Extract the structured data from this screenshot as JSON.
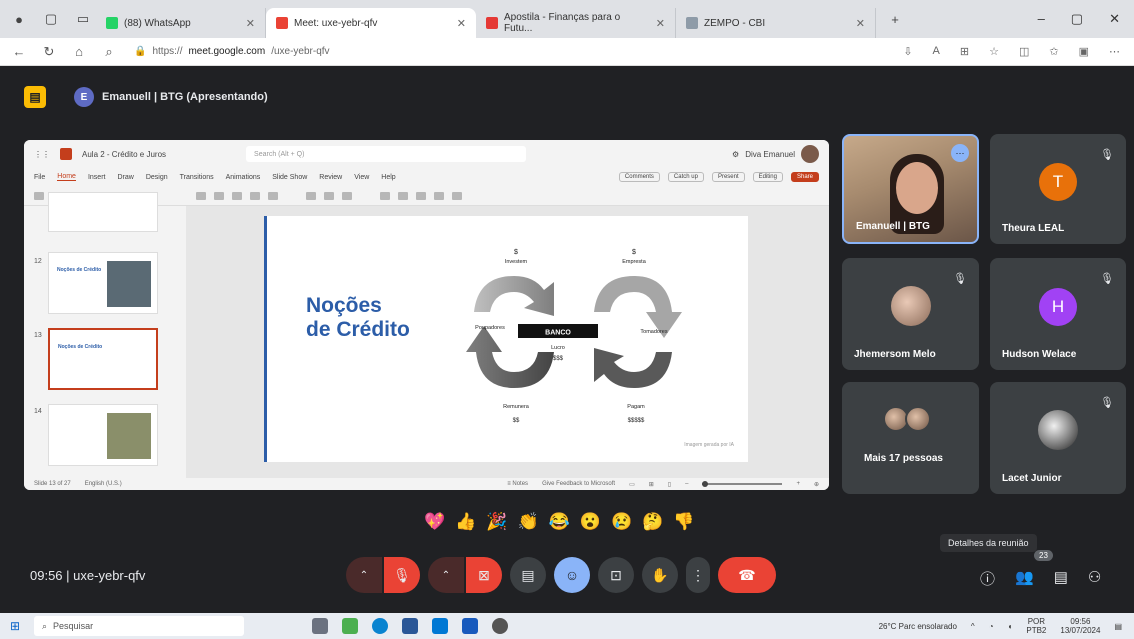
{
  "browser": {
    "tabs": [
      {
        "label": "(88) WhatsApp",
        "color": "#25d366"
      },
      {
        "label": "Meet: uxe-yebr-qfv",
        "color": "#ea4335",
        "active": true
      },
      {
        "label": "Apostila - Finanças para o Futu...",
        "color": "#e53935"
      },
      {
        "label": "ZEMPO - CBI",
        "color": "#8e9ba8"
      }
    ],
    "url_prefix": "https://",
    "url_domain": "meet.google.com",
    "url_path": "/uxe-yebr-qfv"
  },
  "meet": {
    "presenter_initial": "E",
    "presenter_label": "Emanuell | BTG (Apresentando)",
    "meeting_time": "09:56",
    "meeting_code": "uxe-yebr-qfv",
    "details_tooltip": "Detalhes da reunião",
    "participant_count": "23"
  },
  "ppt": {
    "doc_title": "Aula 2 - Crédito e Juros",
    "search_placeholder": "Search (Alt + Q)",
    "user_name": "Diva Emanuel",
    "menu": [
      "File",
      "Home",
      "Insert",
      "Draw",
      "Design",
      "Transitions",
      "Animations",
      "Slide Show",
      "Review",
      "View",
      "Help"
    ],
    "comments": "Comments",
    "catch_up": "Catch up",
    "present": "Present",
    "editing": "Editing",
    "share": "Share",
    "thumb_title": "Noções de Crédito",
    "slide_title_line1": "Noções",
    "slide_title_line2": "de Crédito",
    "slide_caption": "Imagem gerada por IA",
    "status_left": "Slide 13 of 27",
    "status_lang": "English (U.S.)",
    "status_feedback": "Give Feedback to Microsoft",
    "diagram": {
      "top_left_sym": "$",
      "top_left": "Investem",
      "top_right_sym": "$",
      "top_right": "Empresta",
      "left": "Poupadores",
      "center": "BANCO",
      "right": "Tomadores",
      "lucro": "Lucro",
      "lucro_val": "$$$",
      "bottom_left": "Remunera",
      "bottom_left_val": "$$",
      "bottom_right": "Pagam",
      "bottom_right_val": "$$$$$"
    }
  },
  "participants": [
    {
      "name": "Emanuell | BTG"
    },
    {
      "name": "Theura LEAL",
      "initial": "T",
      "color": "#e8710a"
    },
    {
      "name": "Jhemersom Melo"
    },
    {
      "name": "Hudson Welace",
      "initial": "H",
      "color": "#a142f4"
    },
    {
      "name": "Mais 17 pessoas"
    },
    {
      "name": "Lacet Junior"
    }
  ],
  "reactions": [
    "💖",
    "👍",
    "🎉",
    "👏",
    "😂",
    "😮",
    "😢",
    "🤔",
    "👎"
  ],
  "taskbar": {
    "search": "Pesquisar",
    "weather": "26°C  Parc ensolarado",
    "lang": "POR",
    "lang2": "PTB2",
    "time": "09:56",
    "date": "13/07/2024"
  }
}
